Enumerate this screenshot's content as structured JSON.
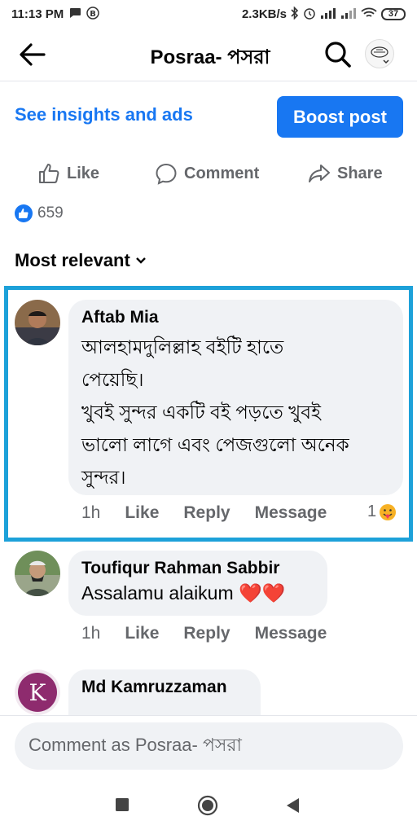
{
  "status_bar": {
    "time": "11:13 PM",
    "network_speed": "2.3KB/s",
    "battery": "37",
    "icons": [
      "message-icon",
      "b-icon",
      "bluetooth-icon",
      "alarm-icon",
      "signal-icon",
      "signal-icon",
      "wifi-icon",
      "battery-icon"
    ]
  },
  "header": {
    "title": "Posraa- পসরা",
    "back_icon": "arrow-left-icon",
    "search_icon": "search-icon",
    "avatar_icon": "page-avatar-dropdown"
  },
  "post_tools": {
    "insights_label": "See insights and ads",
    "boost_label": "Boost post"
  },
  "actions": {
    "like": "Like",
    "comment": "Comment",
    "share": "Share"
  },
  "reactions": {
    "count": "659"
  },
  "sort": {
    "label": "Most relevant"
  },
  "comments": [
    {
      "author": "Aftab Mia",
      "text": "আলহামদুলিল্লাহ বইটি হাতে\nপেয়েছি।\nখুবই সুন্দর একটি বই পড়তে খুবই\nভালো লাগে এবং পেজগুলো অনেক\nসুন্দর।",
      "time": "1h",
      "like": "Like",
      "reply": "Reply",
      "message": "Message",
      "reaction_count": "1",
      "highlighted": true
    },
    {
      "author": "Toufiqur Rahman Sabbir",
      "text": "Assalamu alaikum ❤️❤️",
      "time": "1h",
      "like": "Like",
      "reply": "Reply",
      "message": "Message"
    },
    {
      "author": "Md Kamruzzaman",
      "text": ""
    }
  ],
  "composer": {
    "placeholder": "Comment as Posraa- পসরা"
  },
  "colors": {
    "accent": "#1877f2",
    "highlight_border": "#1da1d9",
    "bubble": "#f0f2f5",
    "muted_text": "#65676b"
  }
}
